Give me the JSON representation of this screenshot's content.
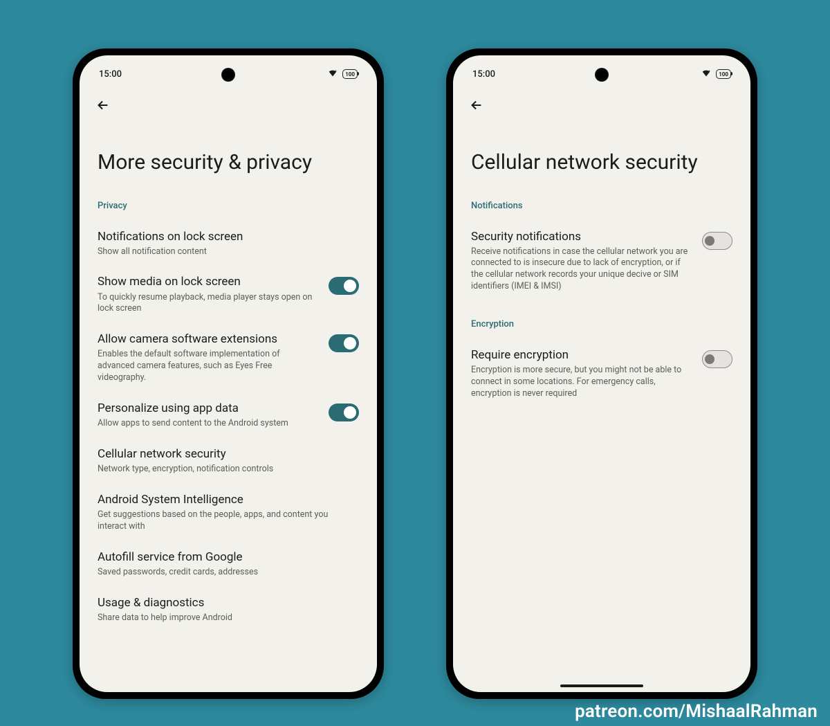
{
  "status": {
    "time": "15:00",
    "battery": "100"
  },
  "left": {
    "title": "More security & privacy",
    "section1": "Privacy",
    "items": [
      {
        "title": "Notifications on lock screen",
        "desc": "Show all notification content"
      },
      {
        "title": "Show media on lock screen",
        "desc": "To quickly resume playback, media player stays open on lock screen"
      },
      {
        "title": "Allow camera software extensions",
        "desc": "Enables the default software implementation of advanced camera features, such as Eyes Free videography."
      },
      {
        "title": "Personalize using app data",
        "desc": "Allow apps to send content to the Android system"
      },
      {
        "title": "Cellular network security",
        "desc": "Network type, encryption, notification controls"
      },
      {
        "title": "Android System Intelligence",
        "desc": "Get suggestions based on the people, apps, and content you interact with"
      },
      {
        "title": "Autofill service from Google",
        "desc": "Saved passwords, credit cards, addresses"
      },
      {
        "title": "Usage & diagnostics",
        "desc": "Share data to help improve Android"
      }
    ]
  },
  "right": {
    "title": "Cellular network security",
    "section1": "Notifications",
    "item1": {
      "title": "Security notifications",
      "desc": "Receive notifications in case the cellular network you are connected to is insecure due to lack of encryption, or if the cellular network records your unique decive or SIM identifiers (IMEI & IMSI)"
    },
    "section2": "Encryption",
    "item2": {
      "title": "Require encryption",
      "desc": "Encryption is more secure, but you might not be able to connect in some locations. For emergency calls, encryption is never required"
    }
  },
  "credit": "patreon.com/MishaalRahman"
}
